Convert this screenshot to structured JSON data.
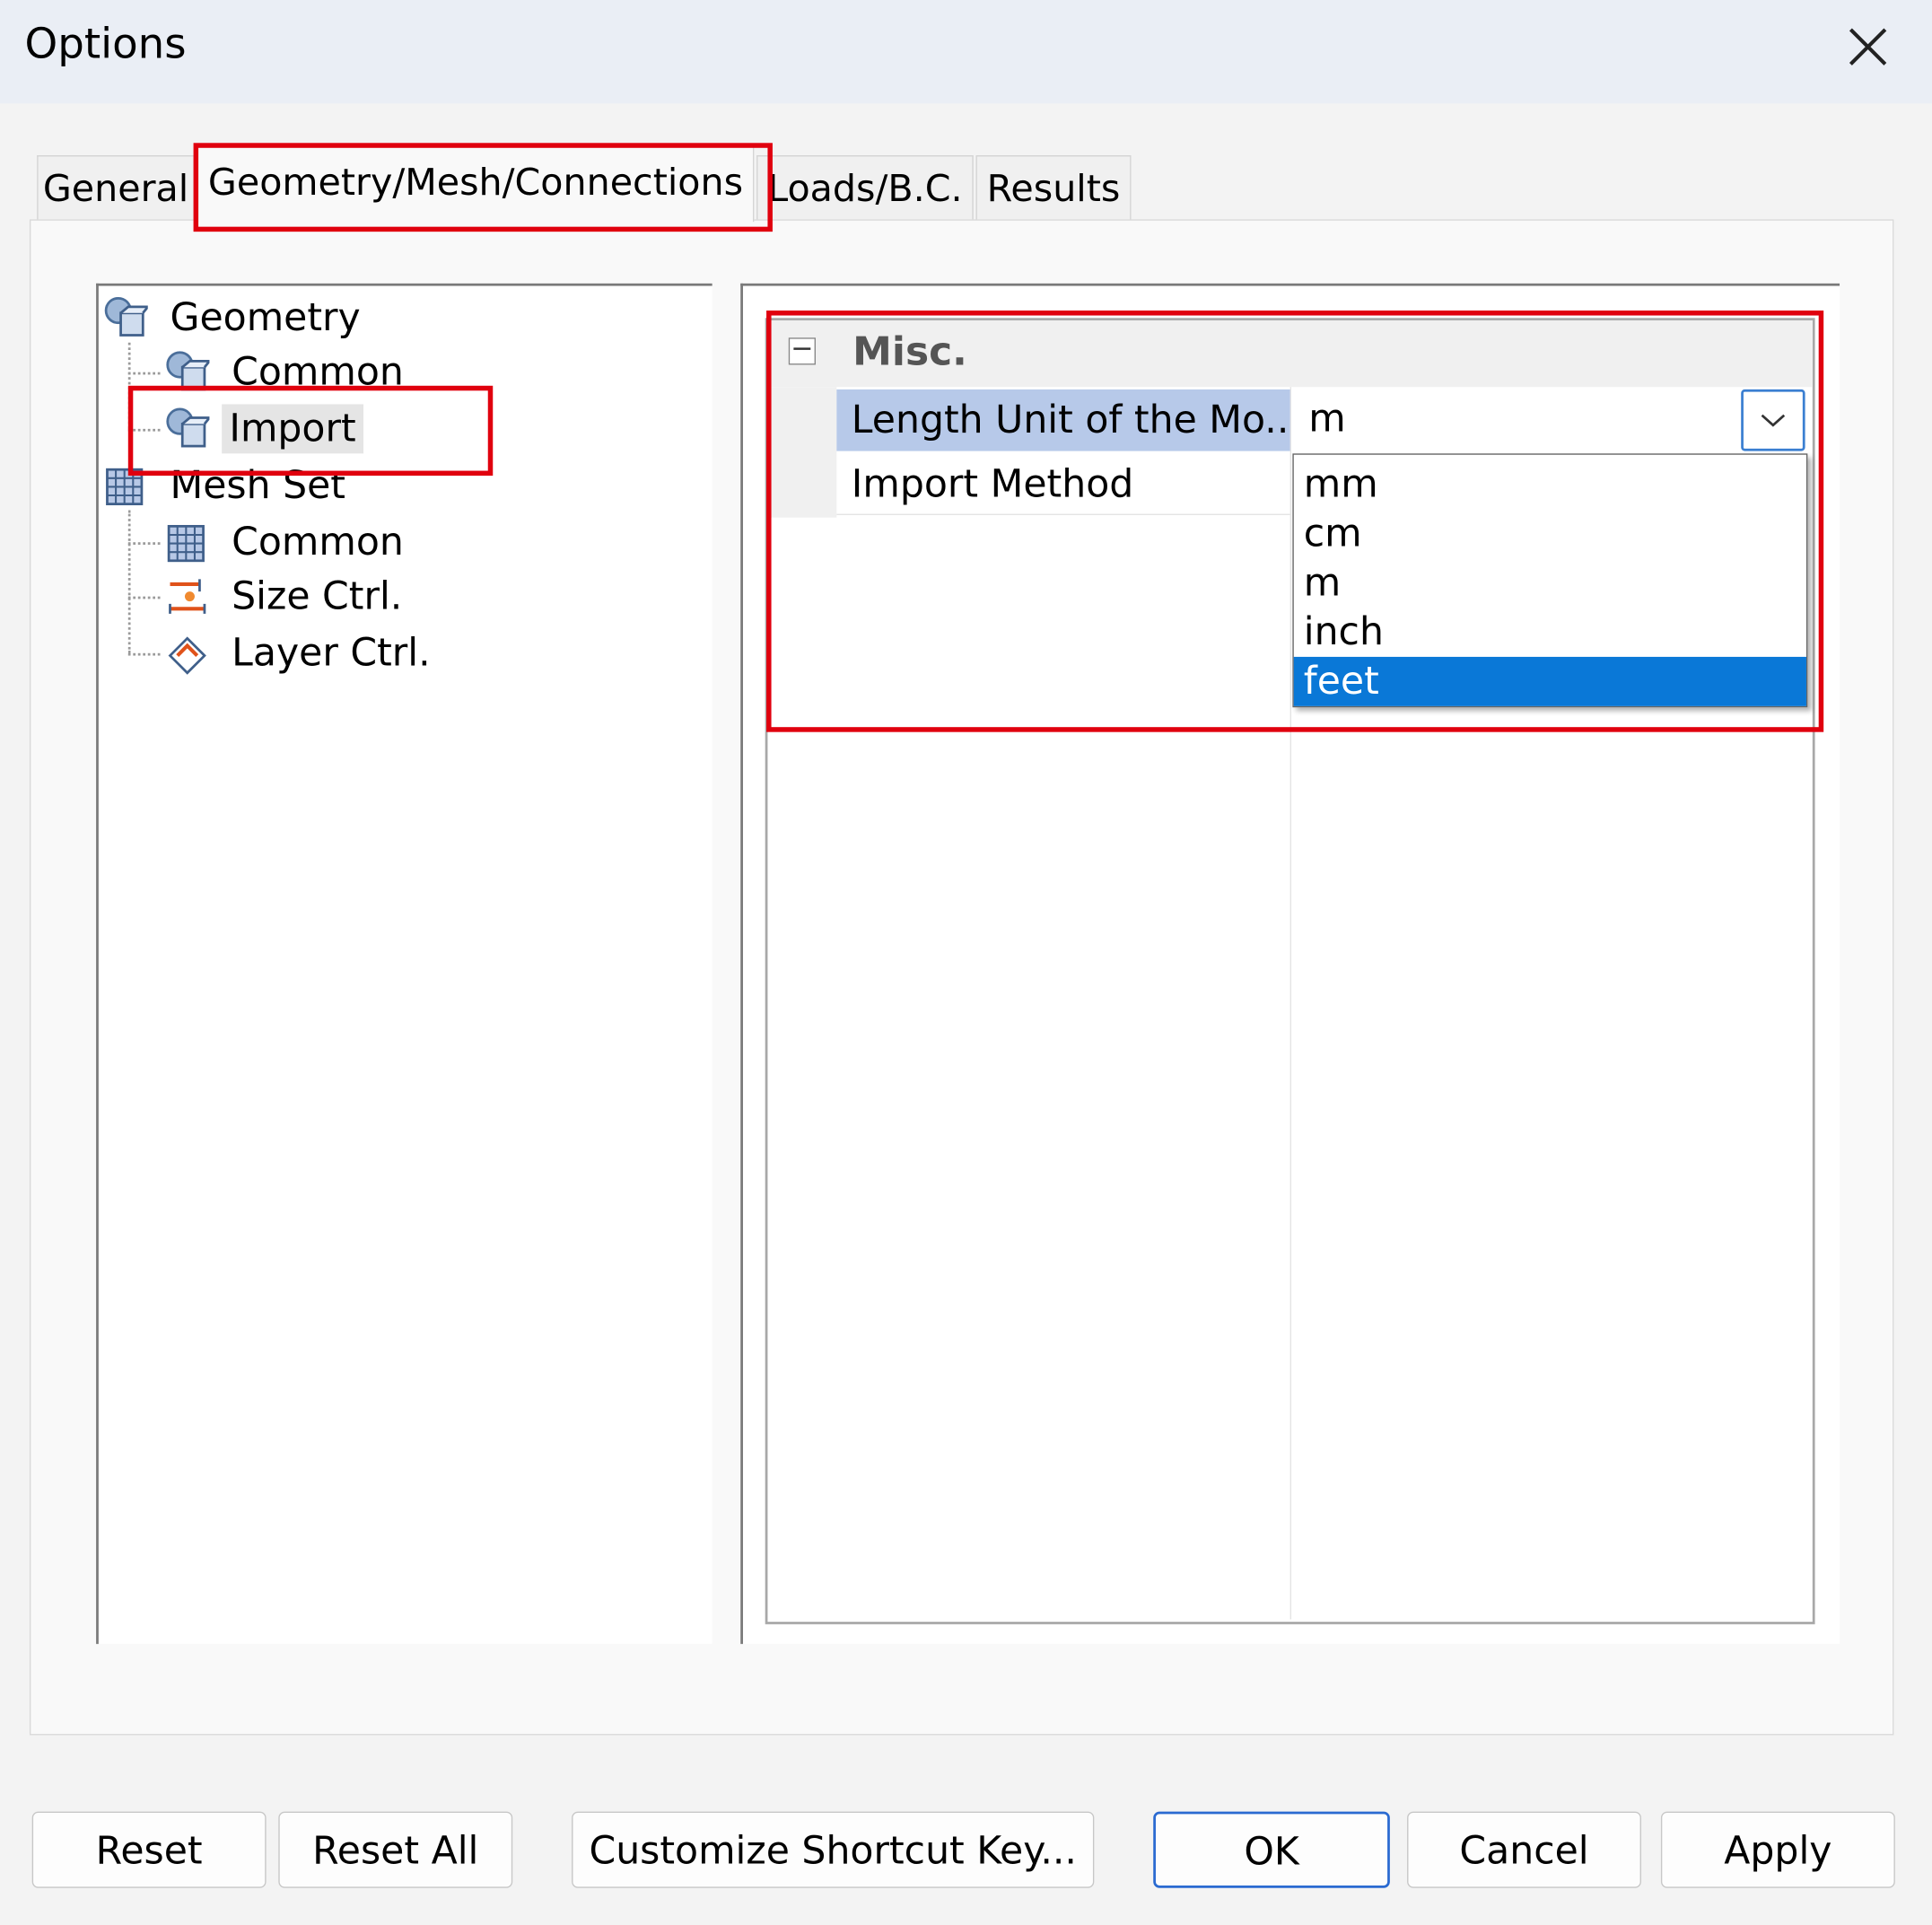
{
  "window": {
    "title": "Options"
  },
  "tabs": [
    "General",
    "Geometry/Mesh/Connections",
    "Loads/B.C.",
    "Results"
  ],
  "active_tab": "Geometry/Mesh/Connections",
  "tree": {
    "items": [
      {
        "label": "Geometry",
        "icon": "geometry-icon",
        "level": 0
      },
      {
        "label": "Common",
        "icon": "geometry-icon",
        "level": 1
      },
      {
        "label": "Import",
        "icon": "geometry-icon",
        "level": 1,
        "selected": true
      },
      {
        "label": "Mesh Set",
        "icon": "mesh-icon",
        "level": 0
      },
      {
        "label": "Common",
        "icon": "mesh-icon",
        "level": 1
      },
      {
        "label": "Size Ctrl.",
        "icon": "size-ctrl-icon",
        "level": 1
      },
      {
        "label": "Layer Ctrl.",
        "icon": "layer-ctrl-icon",
        "level": 1
      }
    ]
  },
  "property_grid": {
    "category": "Misc.",
    "rows": [
      {
        "name": "Length Unit of the Mo...",
        "value": "m"
      },
      {
        "name": "Import Method",
        "value": ""
      }
    ],
    "dropdown": {
      "options": [
        "mm",
        "cm",
        "m",
        "inch",
        "feet"
      ],
      "highlighted": "feet"
    }
  },
  "buttons": {
    "reset": "Reset",
    "reset_all": "Reset All",
    "shortcut": "Customize Shortcut Key...",
    "ok": "OK",
    "cancel": "Cancel",
    "apply": "Apply"
  },
  "colors": {
    "highlight_box": "#e0000e",
    "selection_blue": "#0a78d7",
    "row_selected": "#b7c9e9"
  }
}
